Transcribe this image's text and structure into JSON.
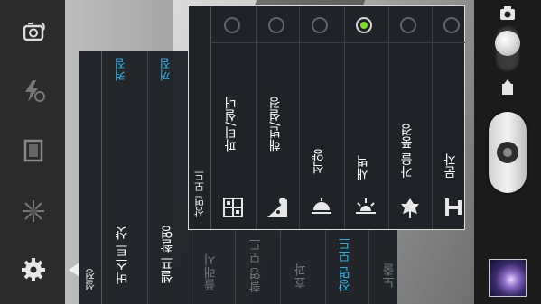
{
  "left_toolbar": {
    "icons": [
      "switch-camera-icon",
      "flash-off-icon",
      "shooting-mode-icon",
      "exposure-icon",
      "settings-icon"
    ]
  },
  "settings_menu": {
    "title": "설정",
    "items": [
      {
        "label": "버스트 샷",
        "value": "켜짐"
      },
      {
        "label": "셀프 촬영",
        "value": "꺼짐"
      },
      {
        "label": "플래시",
        "value": ""
      },
      {
        "label": "촬영 모드",
        "value": ""
      },
      {
        "label": "효과",
        "value": ""
      },
      {
        "label": "장면 모드",
        "value": ""
      },
      {
        "label": "노출",
        "value": ""
      }
    ]
  },
  "scene_menu": {
    "title": "장면 모드",
    "options": [
      {
        "label": "파티/실내",
        "icon": "party-icon",
        "selected": false
      },
      {
        "label": "해변/설경",
        "icon": "beach-icon",
        "selected": false
      },
      {
        "label": "석양",
        "icon": "sunset-icon",
        "selected": false
      },
      {
        "label": "새벽",
        "icon": "dawn-icon",
        "selected": true
      },
      {
        "label": "가을 풍경",
        "icon": "autumn-icon",
        "selected": false
      },
      {
        "label": "문자",
        "icon": "text-icon",
        "selected": false
      }
    ]
  },
  "right_bar": {
    "icons": [
      "camera-mode-icon",
      "camcorder-mode-icon",
      "shutter-button",
      "gallery-thumbnail"
    ]
  },
  "colors": {
    "value_blue": "#23b3ee",
    "selected_green": "#7bdc2c",
    "menu_bg": "#1f2327",
    "dim_text": "#8a8f93"
  }
}
